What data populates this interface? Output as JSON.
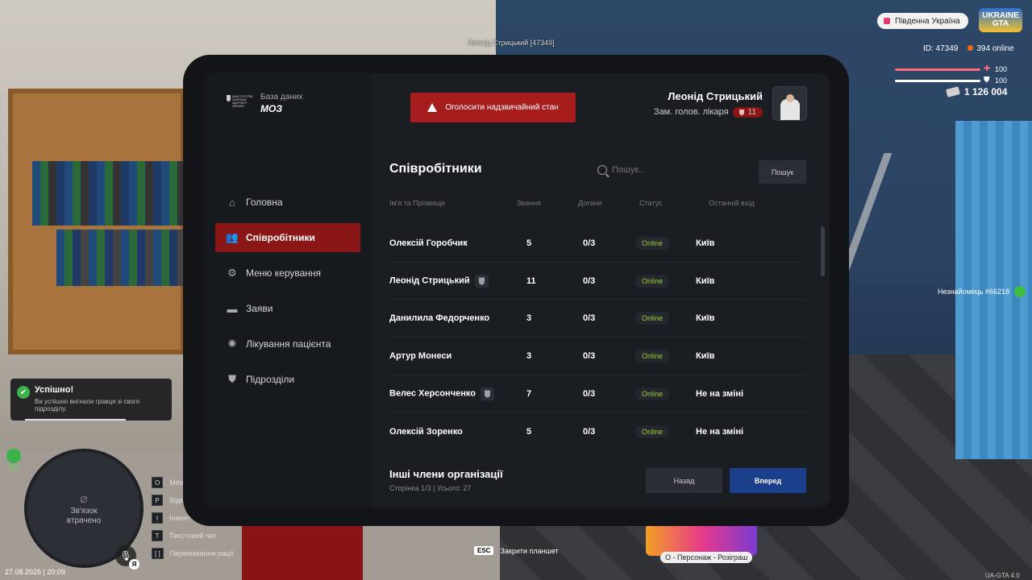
{
  "hud": {
    "player_tag": "Леонід Стрицький [47349]",
    "server": "Південна Україна",
    "logo": "UKRAINE GTA",
    "id_label": "ID: 47349",
    "online": "394 online",
    "hp": "100",
    "armor": "100",
    "money": "1 126 004",
    "stranger": "Незнайомець #66218",
    "toast_title": "Успішно!",
    "toast_text": "Ви успішно вигнали гравця зі свого підрозділу.",
    "gz": "GZ",
    "connection_lost": "Зв'язок втрачено",
    "mic_key": "Я",
    "datetime": "27.08.2026 | 20:09",
    "keys": [
      {
        "key": "O",
        "label": "Мен"
      },
      {
        "key": "P",
        "label": "Відк"
      },
      {
        "key": "I",
        "label": "Інвент"
      },
      {
        "key": "T",
        "label": "Текстовий чат"
      },
      {
        "key": "[ ]",
        "label": "Перемикання рації"
      }
    ],
    "esc_key": "ESC",
    "esc_label": "Закрити планшет",
    "promo_label": "Персонаж - Розіграш",
    "promo_key": "O",
    "version": "UA-GTA 4.0"
  },
  "tablet": {
    "org_small": "МІНІСТЕРСТВО ОХОРОНИ ЗДОРОВ'Я УКРАЇНИ",
    "db_label": "База даних",
    "org_name": "МОЗ",
    "alert_button": "Оголосити надзвичайний стан",
    "user_name": "Леонід Стрицький",
    "user_role": "Зам. голов. лікаря",
    "user_rank": "11",
    "nav": [
      {
        "label": "Головна",
        "icon": "home-icon"
      },
      {
        "label": "Співробітники",
        "icon": "users-icon",
        "active": true
      },
      {
        "label": "Меню керування",
        "icon": "gear-icon"
      },
      {
        "label": "Заяви",
        "icon": "folder-icon"
      },
      {
        "label": "Лікування пацієнта",
        "icon": "virus-icon"
      },
      {
        "label": "Підрозділи",
        "icon": "shield-icon"
      }
    ],
    "page_title": "Співробітники",
    "search_placeholder": "Пошук..",
    "search_button": "Пошук",
    "columns": [
      "Ім'я та Прізвище",
      "Звання",
      "Догани",
      "Статус",
      "Останній вхід"
    ],
    "employees": [
      {
        "name": "Олексій Горобчик",
        "badge": false,
        "rank": "5",
        "reprimands": "0/3",
        "status": "Online",
        "last": "Київ"
      },
      {
        "name": "Леонід Стрицький",
        "badge": true,
        "rank": "11",
        "reprimands": "0/3",
        "status": "Online",
        "last": "Київ"
      },
      {
        "name": "Данилила Федорченко",
        "badge": false,
        "rank": "3",
        "reprimands": "0/3",
        "status": "Online",
        "last": "Київ"
      },
      {
        "name": "Артур Монеси",
        "badge": false,
        "rank": "3",
        "reprimands": "0/3",
        "status": "Online",
        "last": "Київ"
      },
      {
        "name": "Велес Херсонченко",
        "badge": true,
        "rank": "7",
        "reprimands": "0/3",
        "status": "Online",
        "last": "Не на зміні"
      },
      {
        "name": "Олексій Зоренко",
        "badge": false,
        "rank": "5",
        "reprimands": "0/3",
        "status": "Online",
        "last": "Не на зміні"
      }
    ],
    "others_title": "Інші члени організації",
    "pager": "Сторінка 1/3 | Усього: 27",
    "back_button": "Назад",
    "next_button": "Вперед"
  }
}
